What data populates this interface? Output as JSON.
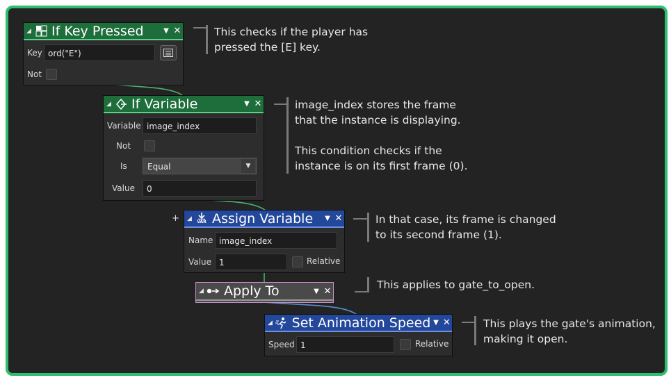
{
  "colors": {
    "frame": "#2fbe6f",
    "canvas": "#232323",
    "condition_header": "#1e6e3c",
    "action_header": "#23479a",
    "applyto_header": "#4a4a4a",
    "applyto_border": "#c98fc9"
  },
  "blocks": {
    "if_key_pressed": {
      "title": "If Key Pressed",
      "icon": "keyboard-grid-icon",
      "key_label": "Key",
      "key_value": "ord(\"E\")",
      "not_label": "Not"
    },
    "if_variable": {
      "title": "If Variable",
      "icon": "branch-diamond-icon",
      "variable_label": "Variable",
      "variable_value": "image_index",
      "not_label": "Not",
      "is_label": "Is",
      "is_value": "Equal",
      "value_label": "Value",
      "value_value": "0"
    },
    "assign_variable": {
      "title": "Assign Variable",
      "icon": "var-download-icon",
      "icon_text": "VAR",
      "expand": "+",
      "name_label": "Name",
      "name_value": "image_index",
      "value_label": "Value",
      "value_value": "1",
      "relative_label": "Relative"
    },
    "apply_to": {
      "title": "Apply To",
      "icon": "apply-to-arrow-icon"
    },
    "set_animation_speed": {
      "title": "Set Animation Speed",
      "icon": "running-figure-icon",
      "speed_label": "Speed",
      "speed_value": "1",
      "relative_label": "Relative"
    }
  },
  "notes": {
    "note1": [
      "This checks if the player has",
      "pressed the [E] key."
    ],
    "note2": [
      "image_index stores the frame",
      "that the instance is displaying.",
      "",
      "This condition checks if the",
      "instance is on its first frame (0)."
    ],
    "note3": [
      "In that case, its frame is changed",
      "to its second frame (1)."
    ],
    "note4": [
      "This applies to gate_to_open."
    ],
    "note5": [
      "This plays the gate's animation,",
      "making it open."
    ]
  },
  "glyphs": {
    "collapse": "◢",
    "dropdown": "▼",
    "close": "✕"
  }
}
